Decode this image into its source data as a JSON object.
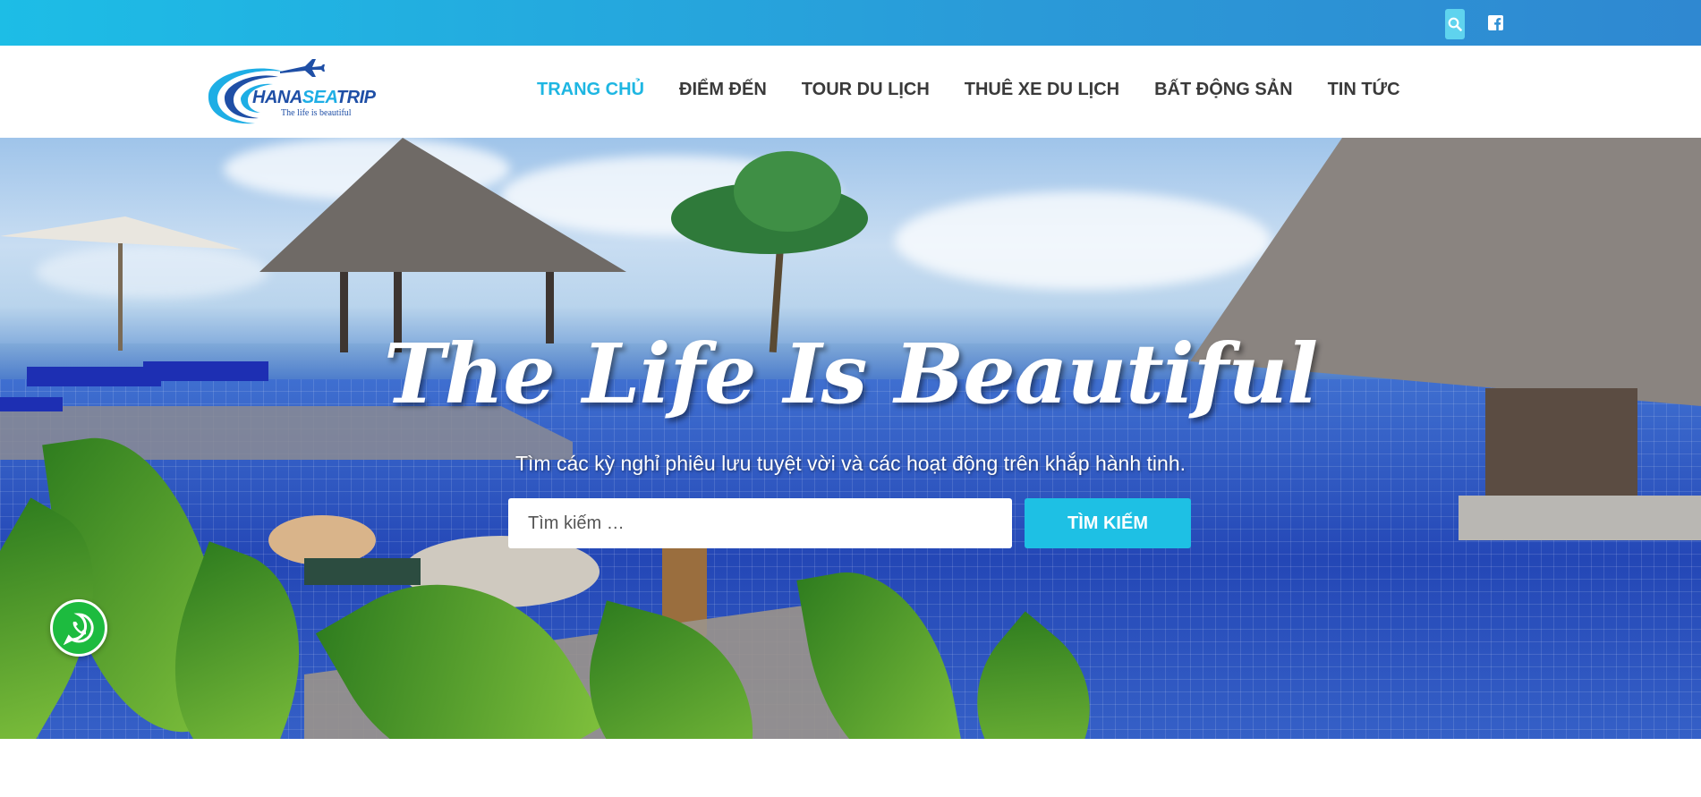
{
  "topbar": {
    "search_icon": "search-icon",
    "social_icon": "facebook-icon",
    "colors": {
      "gradient_start": "#1dbde6",
      "gradient_end": "#2f88d1"
    }
  },
  "logo": {
    "brand_part1": "HANA",
    "brand_part2": "SEA",
    "brand_part3": "TRIP",
    "tagline": "The life is beautiful",
    "icon": "airplane-icon"
  },
  "nav": {
    "items": [
      {
        "label": "TRANG CHỦ",
        "active": true
      },
      {
        "label": "ĐIỂM ĐẾN",
        "active": false
      },
      {
        "label": "TOUR DU LỊCH",
        "active": false
      },
      {
        "label": "THUÊ XE DU LỊCH",
        "active": false
      },
      {
        "label": "BẤT ĐỘNG SẢN",
        "active": false
      },
      {
        "label": "TIN TỨC",
        "active": false
      }
    ],
    "active_color": "#1eb6e2"
  },
  "hero": {
    "title": "The Life Is Beautiful",
    "subtitle": "Tìm các kỳ nghỉ phiêu lưu tuyệt vời và các hoạt động trên khắp hành tinh.",
    "search_placeholder": "Tìm kiếm …",
    "search_button": "TÌM KIẾM",
    "button_color": "#1ec0e4"
  },
  "floating": {
    "whatsapp_icon": "whatsapp-icon",
    "whatsapp_color": "#1dbb3f"
  }
}
